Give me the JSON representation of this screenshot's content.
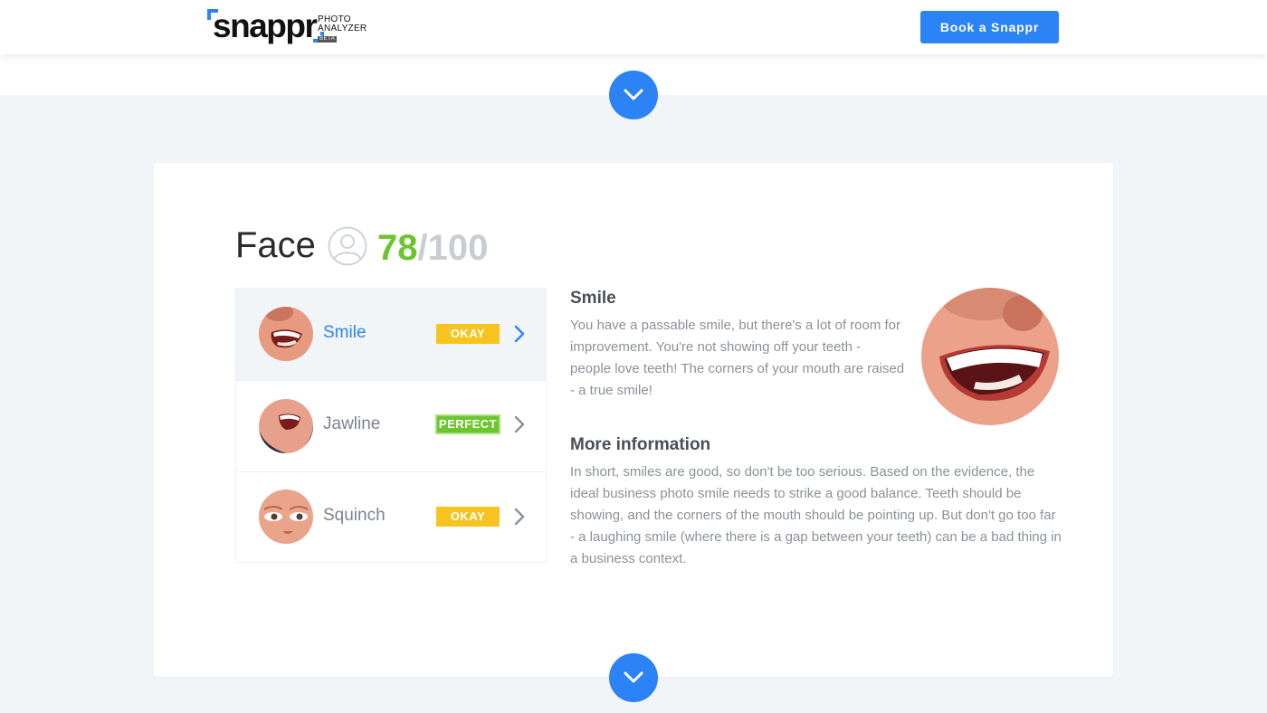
{
  "header": {
    "logo_word": "snappr",
    "logo_sub1": "PHOTO",
    "logo_sub2": "ANALYZER",
    "logo_beta": "BETA",
    "book_button": "Book a Snappr"
  },
  "colors": {
    "accent": "#2b83f6",
    "okay": "#f7c41f",
    "perfect": "#6cc52e",
    "background": "#f2f5f8"
  },
  "section": {
    "title": "Face",
    "icon": "user-icon",
    "score_value": "78",
    "score_max": "/100",
    "score_fraction": 0.78
  },
  "features": [
    {
      "label": "Smile",
      "badge": "OKAY",
      "badge_type": "okay",
      "active": true
    },
    {
      "label": "Jawline",
      "badge": "PERFECT",
      "badge_type": "perfect",
      "active": false
    },
    {
      "label": "Squinch",
      "badge": "OKAY",
      "badge_type": "okay",
      "active": false
    }
  ],
  "detail": {
    "heading": "Smile",
    "body": "You have a passable smile, but there's a lot of room for improvement. You're not showing off your teeth - people love teeth! The corners of your mouth are raised - a true smile!",
    "more_heading": "More information",
    "more_body": "In short, smiles are good, so don't be too serious. Based on the evidence, the ideal business photo smile needs to strike a good balance. Teeth should be showing, and the corners of the mouth should be pointing up. But don't go too far - a laughing smile (where there is a gap between your teeth) can be a bad thing in a business context."
  }
}
